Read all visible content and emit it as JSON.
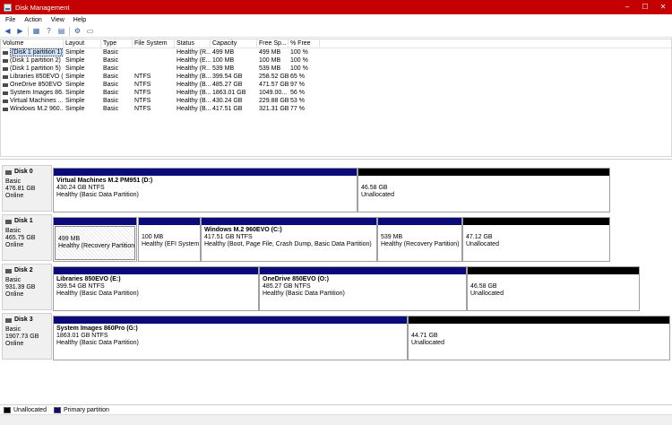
{
  "window": {
    "title": "Disk Management"
  },
  "menu": [
    "File",
    "Action",
    "View",
    "Help"
  ],
  "volume_list": {
    "columns": [
      "Volume",
      "Layout",
      "Type",
      "File System",
      "Status",
      "Capacity",
      "Free Sp...",
      "% Free"
    ],
    "rows": [
      [
        "(Disk 1 partition 1)",
        "Simple",
        "Basic",
        "",
        "Healthy (R...",
        "499 MB",
        "499 MB",
        "100 %"
      ],
      [
        "(Disk 1 partition 2)",
        "Simple",
        "Basic",
        "",
        "Healthy (E...",
        "100 MB",
        "100 MB",
        "100 %"
      ],
      [
        "(Disk 1 partition 5)",
        "Simple",
        "Basic",
        "",
        "Healthy (R...",
        "539 MB",
        "539 MB",
        "100 %"
      ],
      [
        "Libraries 850EVO (...",
        "Simple",
        "Basic",
        "NTFS",
        "Healthy (B...",
        "399.54 GB",
        "258.52 GB",
        "65 %"
      ],
      [
        "OneDrive 850EVO ...",
        "Simple",
        "Basic",
        "NTFS",
        "Healthy (B...",
        "485.27 GB",
        "471.57 GB",
        "97 %"
      ],
      [
        "System Images 86...",
        "Simple",
        "Basic",
        "NTFS",
        "Healthy (B...",
        "1863.01 GB",
        "1049.00...",
        "56 %"
      ],
      [
        "Virtual Machines ...",
        "Simple",
        "Basic",
        "NTFS",
        "Healthy (B...",
        "430.24 GB",
        "229.88 GB",
        "53 %"
      ],
      [
        "Windows M.2 960...",
        "Simple",
        "Basic",
        "NTFS",
        "Healthy (B...",
        "417.51 GB",
        "321.31 GB",
        "77 %"
      ]
    ]
  },
  "disks": [
    {
      "name": "Disk 0",
      "type": "Basic",
      "size": "476.81 GB",
      "status": "Online",
      "partitions": [
        {
          "title": "Virtual Machines M.2 PM951  (D:)",
          "line2": "430.24 GB NTFS",
          "line3": "Healthy (Basic Data Partition)",
          "kind": "primary"
        },
        {
          "title": "",
          "line2": "46.58 GB",
          "line3": "Unallocated",
          "kind": "unallocated"
        }
      ]
    },
    {
      "name": "Disk 1",
      "type": "Basic",
      "size": "465.75 GB",
      "status": "Online",
      "partitions": [
        {
          "title": "",
          "line2": "499 MB",
          "line3": "Healthy (Recovery Partition)",
          "kind": "primary",
          "selected": true
        },
        {
          "title": "",
          "line2": "100 MB",
          "line3": "Healthy (EFI System P",
          "kind": "primary"
        },
        {
          "title": "Windows M.2 960EVO  (C:)",
          "line2": "417.51 GB NTFS",
          "line3": "Healthy (Boot, Page File, Crash Dump, Basic Data Partition)",
          "kind": "primary"
        },
        {
          "title": "",
          "line2": "539 MB",
          "line3": "Healthy (Recovery Partition)",
          "kind": "primary"
        },
        {
          "title": "",
          "line2": "47.12 GB",
          "line3": "Unallocated",
          "kind": "unallocated"
        }
      ]
    },
    {
      "name": "Disk 2",
      "type": "Basic",
      "size": "931.39 GB",
      "status": "Online",
      "partitions": [
        {
          "title": "Libraries 850EVO  (E:)",
          "line2": "399.54 GB NTFS",
          "line3": "Healthy (Basic Data Partition)",
          "kind": "primary"
        },
        {
          "title": "OneDrive 850EVO  (O:)",
          "line2": "485.27 GB NTFS",
          "line3": "Healthy (Basic Data Partition)",
          "kind": "primary"
        },
        {
          "title": "",
          "line2": "46.58 GB",
          "line3": "Unallocated",
          "kind": "unallocated"
        }
      ]
    },
    {
      "name": "Disk 3",
      "type": "Basic",
      "size": "1907.73 GB",
      "status": "Online",
      "partitions": [
        {
          "title": "System Images 860Pro  (G:)",
          "line2": "1863.01 GB NTFS",
          "line3": "Healthy (Basic Data Partition)",
          "kind": "primary"
        },
        {
          "title": "",
          "line2": "44.71 GB",
          "line3": "Unallocated",
          "kind": "unallocated"
        }
      ]
    }
  ],
  "legend": {
    "unallocated": "Unallocated",
    "primary": "Primary partition"
  },
  "colors": {
    "titlebar": "#c50000",
    "primary": "#0a0a7a",
    "unallocated": "#000000"
  }
}
